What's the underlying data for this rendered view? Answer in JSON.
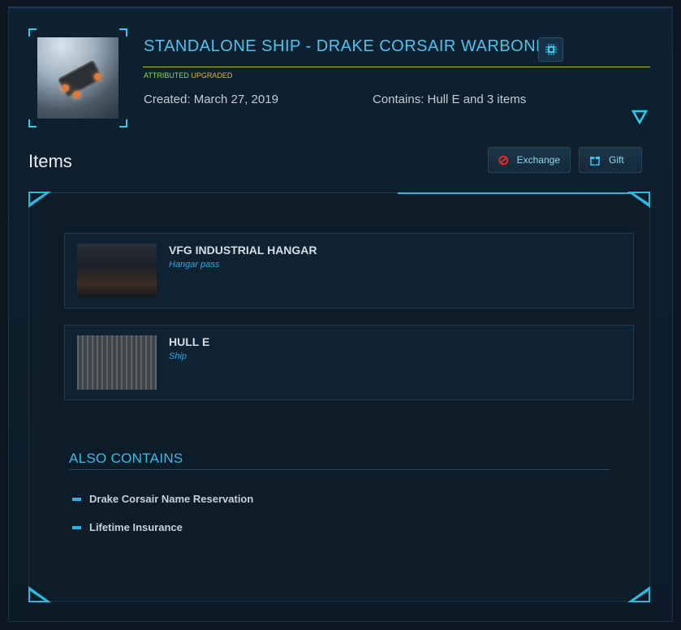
{
  "pledge": {
    "title": "STANDALONE SHIP - DRAKE CORSAIR WARBOND",
    "tags": {
      "attributed": "ATTRIBUTED",
      "upgraded": "UPGRADED"
    },
    "created": "Created: March 27, 2019",
    "contains": "Contains: Hull E and 3 items",
    "thumbnail_icon": "drake-corsair-ship-image",
    "chip_icon": "microchip-icon"
  },
  "items_section": {
    "heading": "Items",
    "exchange_label": "Exchange",
    "gift_label": "Gift"
  },
  "items": [
    {
      "name": "VFG INDUSTRIAL HANGAR",
      "type": "Hangar pass"
    },
    {
      "name": "HULL E",
      "type": "Ship"
    }
  ],
  "also_contains": {
    "heading": "ALSO CONTAINS",
    "entries": [
      "Drake Corsair Name Reservation",
      "Lifetime Insurance"
    ]
  },
  "colors": {
    "accent": "#2ab4e6",
    "title": "#4ec3ef",
    "attributed": "#7ee53a",
    "upgraded": "#d8b83b",
    "rule_gold": "#c7a44a"
  }
}
